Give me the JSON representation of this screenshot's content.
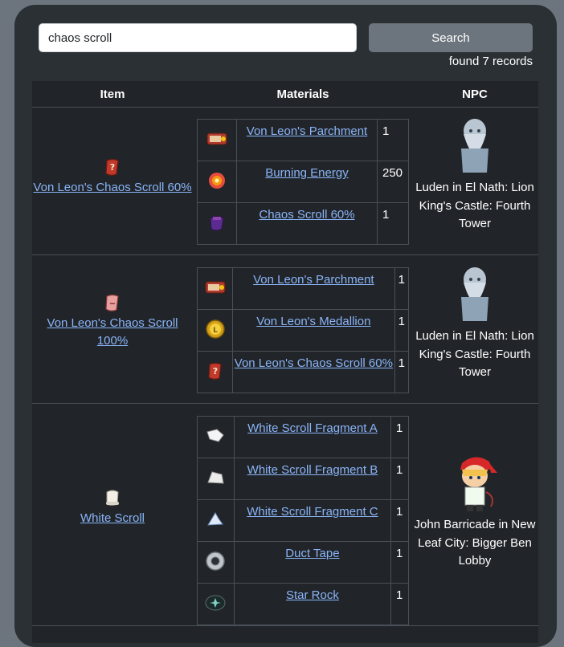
{
  "search": {
    "value": "chaos scroll",
    "placeholder": "",
    "button_label": "Search",
    "found_text": "found 7 records"
  },
  "table": {
    "headers": [
      "Item",
      "Materials",
      "NPC"
    ],
    "rows": [
      {
        "item": "Von Leon's Chaos Scroll 60%",
        "item_icon": "red-chaos-scroll-icon",
        "materials": [
          {
            "name": "Von Leon's Parchment",
            "qty": "1",
            "icon": "parchment-icon"
          },
          {
            "name": "Burning Energy",
            "qty": "250",
            "icon": "burning-energy-icon"
          },
          {
            "name": "Chaos Scroll 60%",
            "qty": "1",
            "icon": "purple-scroll-icon"
          }
        ],
        "npc": "Luden in El Nath: Lion King's Castle: Fourth Tower",
        "npc_icon": "luden-npc-icon"
      },
      {
        "item": "Von Leon's Chaos Scroll 100%",
        "item_icon": "pink-chaos-scroll-icon",
        "materials": [
          {
            "name": "Von Leon's Parchment",
            "qty": "1",
            "icon": "parchment-icon"
          },
          {
            "name": "Von Leon's Medallion",
            "qty": "1",
            "icon": "medallion-icon"
          },
          {
            "name": "Von Leon's Chaos Scroll 60%",
            "qty": "1",
            "icon": "red-chaos-scroll-icon"
          }
        ],
        "npc": "Luden in El Nath: Lion King's Castle: Fourth Tower",
        "npc_icon": "luden-npc-icon"
      },
      {
        "item": "White Scroll",
        "item_icon": "white-scroll-icon",
        "materials": [
          {
            "name": "White Scroll Fragment A",
            "qty": "1",
            "icon": "fragment-a-icon"
          },
          {
            "name": "White Scroll Fragment B",
            "qty": "1",
            "icon": "fragment-b-icon"
          },
          {
            "name": "White Scroll Fragment C",
            "qty": "1",
            "icon": "fragment-c-icon"
          },
          {
            "name": "Duct Tape",
            "qty": "1",
            "icon": "duct-tape-icon"
          },
          {
            "name": "Star Rock",
            "qty": "1",
            "icon": "star-rock-icon"
          }
        ],
        "npc": "John Barricade in New Leaf City: Bigger Ben Lobby",
        "npc_icon": "john-barricade-npc-icon"
      }
    ]
  },
  "colors": {
    "page_bg": "#6c757d",
    "panel_bg": "#2b3035",
    "table_bg": "#212529",
    "link": "#8ab4f8",
    "border": "#495057"
  }
}
